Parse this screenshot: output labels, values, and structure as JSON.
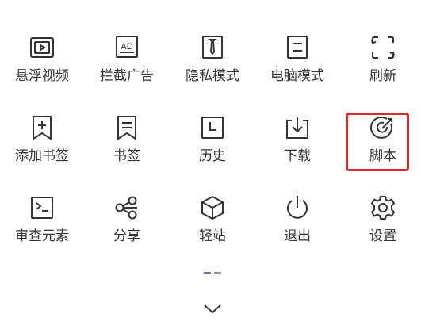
{
  "menu": {
    "items": [
      {
        "label": "悬浮视频",
        "icon": "floating-video-icon"
      },
      {
        "label": "拦截广告",
        "icon": "ad-block-icon"
      },
      {
        "label": "隐私模式",
        "icon": "privacy-mode-icon"
      },
      {
        "label": "电脑模式",
        "icon": "desktop-mode-icon"
      },
      {
        "label": "刷新",
        "icon": "refresh-icon"
      },
      {
        "label": "添加书签",
        "icon": "add-bookmark-icon"
      },
      {
        "label": "书签",
        "icon": "bookmark-icon"
      },
      {
        "label": "历史",
        "icon": "history-icon"
      },
      {
        "label": "下载",
        "icon": "download-icon"
      },
      {
        "label": "脚本",
        "icon": "script-icon"
      },
      {
        "label": "审查元素",
        "icon": "inspect-element-icon"
      },
      {
        "label": "分享",
        "icon": "share-icon"
      },
      {
        "label": "轻站",
        "icon": "light-site-icon"
      },
      {
        "label": "退出",
        "icon": "power-icon"
      },
      {
        "label": "设置",
        "icon": "gear-icon"
      }
    ],
    "icon_text": {
      "ad": "AD"
    }
  },
  "colors": {
    "icon": "#333333",
    "highlight": "#e0292f",
    "pager_active": "#4a6fd8",
    "pager_inactive": "#8a8fa0"
  },
  "pager": {
    "pages": 2,
    "current": 1
  },
  "collapse_icon": "chevron-down-icon"
}
